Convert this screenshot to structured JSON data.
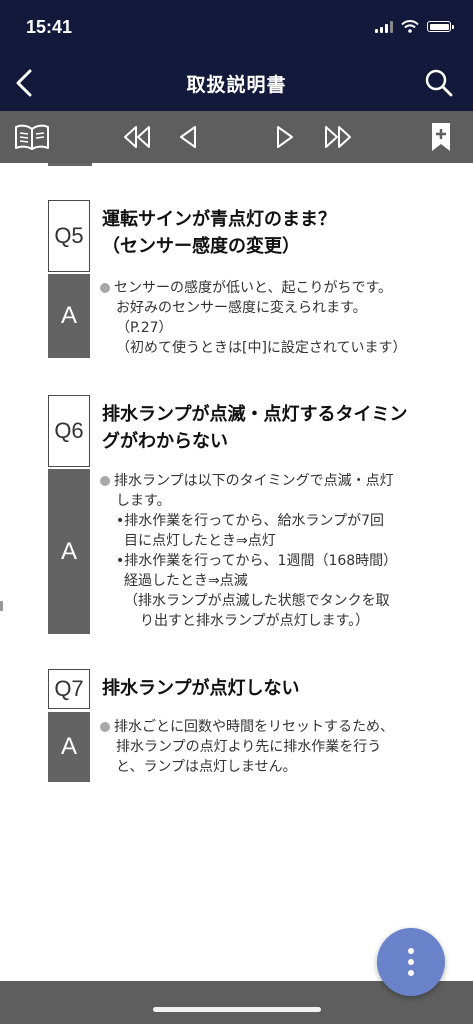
{
  "status": {
    "time": "15:41"
  },
  "header": {
    "title": "取扱説明書"
  },
  "qa": [
    {
      "q_label": "Q5",
      "question_lines": [
        "運転サインが青点灯のまま？",
        "（センサー感度の変更）"
      ],
      "a_label": "A",
      "answer_lines": [
        "センサーの感度が低いと、起こりがちです。",
        "お好みのセンサー感度に変えられます。",
        "（P.27）",
        "（初めて使うときは[中]に設定されています）"
      ]
    },
    {
      "q_label": "Q6",
      "question_lines": [
        "排水ランプが点滅・点灯するタイミン",
        "グがわからない"
      ],
      "a_label": "A",
      "answer_lines": [
        "排水ランプは以下のタイミングで点滅・点灯",
        "します。",
        "•排水作業を行ってから、給水ランプが7回",
        "目に点灯したとき⇒点灯",
        "•排水作業を行ってから、1週間（168時間）",
        "経過したとき⇒点滅",
        "（排水ランプが点滅した状態でタンクを取",
        "り出すと排水ランプが点灯します。）"
      ]
    },
    {
      "q_label": "Q7",
      "question_lines": [
        "排水ランプが点灯しない"
      ],
      "a_label": "A",
      "answer_lines": [
        "排水ごとに回数や時間をリセットするため、",
        "排水ランプの点灯より先に排水作業を行う",
        "と、ランプは点灯しません。"
      ]
    }
  ],
  "icons": {
    "back": "chevron-left-icon",
    "search": "search-icon",
    "book": "book-icon",
    "first": "double-triangle-left-icon",
    "prev": "triangle-left-icon",
    "next": "triangle-right-icon",
    "last": "double-triangle-right-icon",
    "bookmark": "bookmark-plus-icon",
    "menu": "more-vertical-icon"
  },
  "colors": {
    "header_bg": "#13193a",
    "toolbar_bg": "#5e5e5e",
    "answer_box": "#636363",
    "fab": "#6a82c9"
  }
}
